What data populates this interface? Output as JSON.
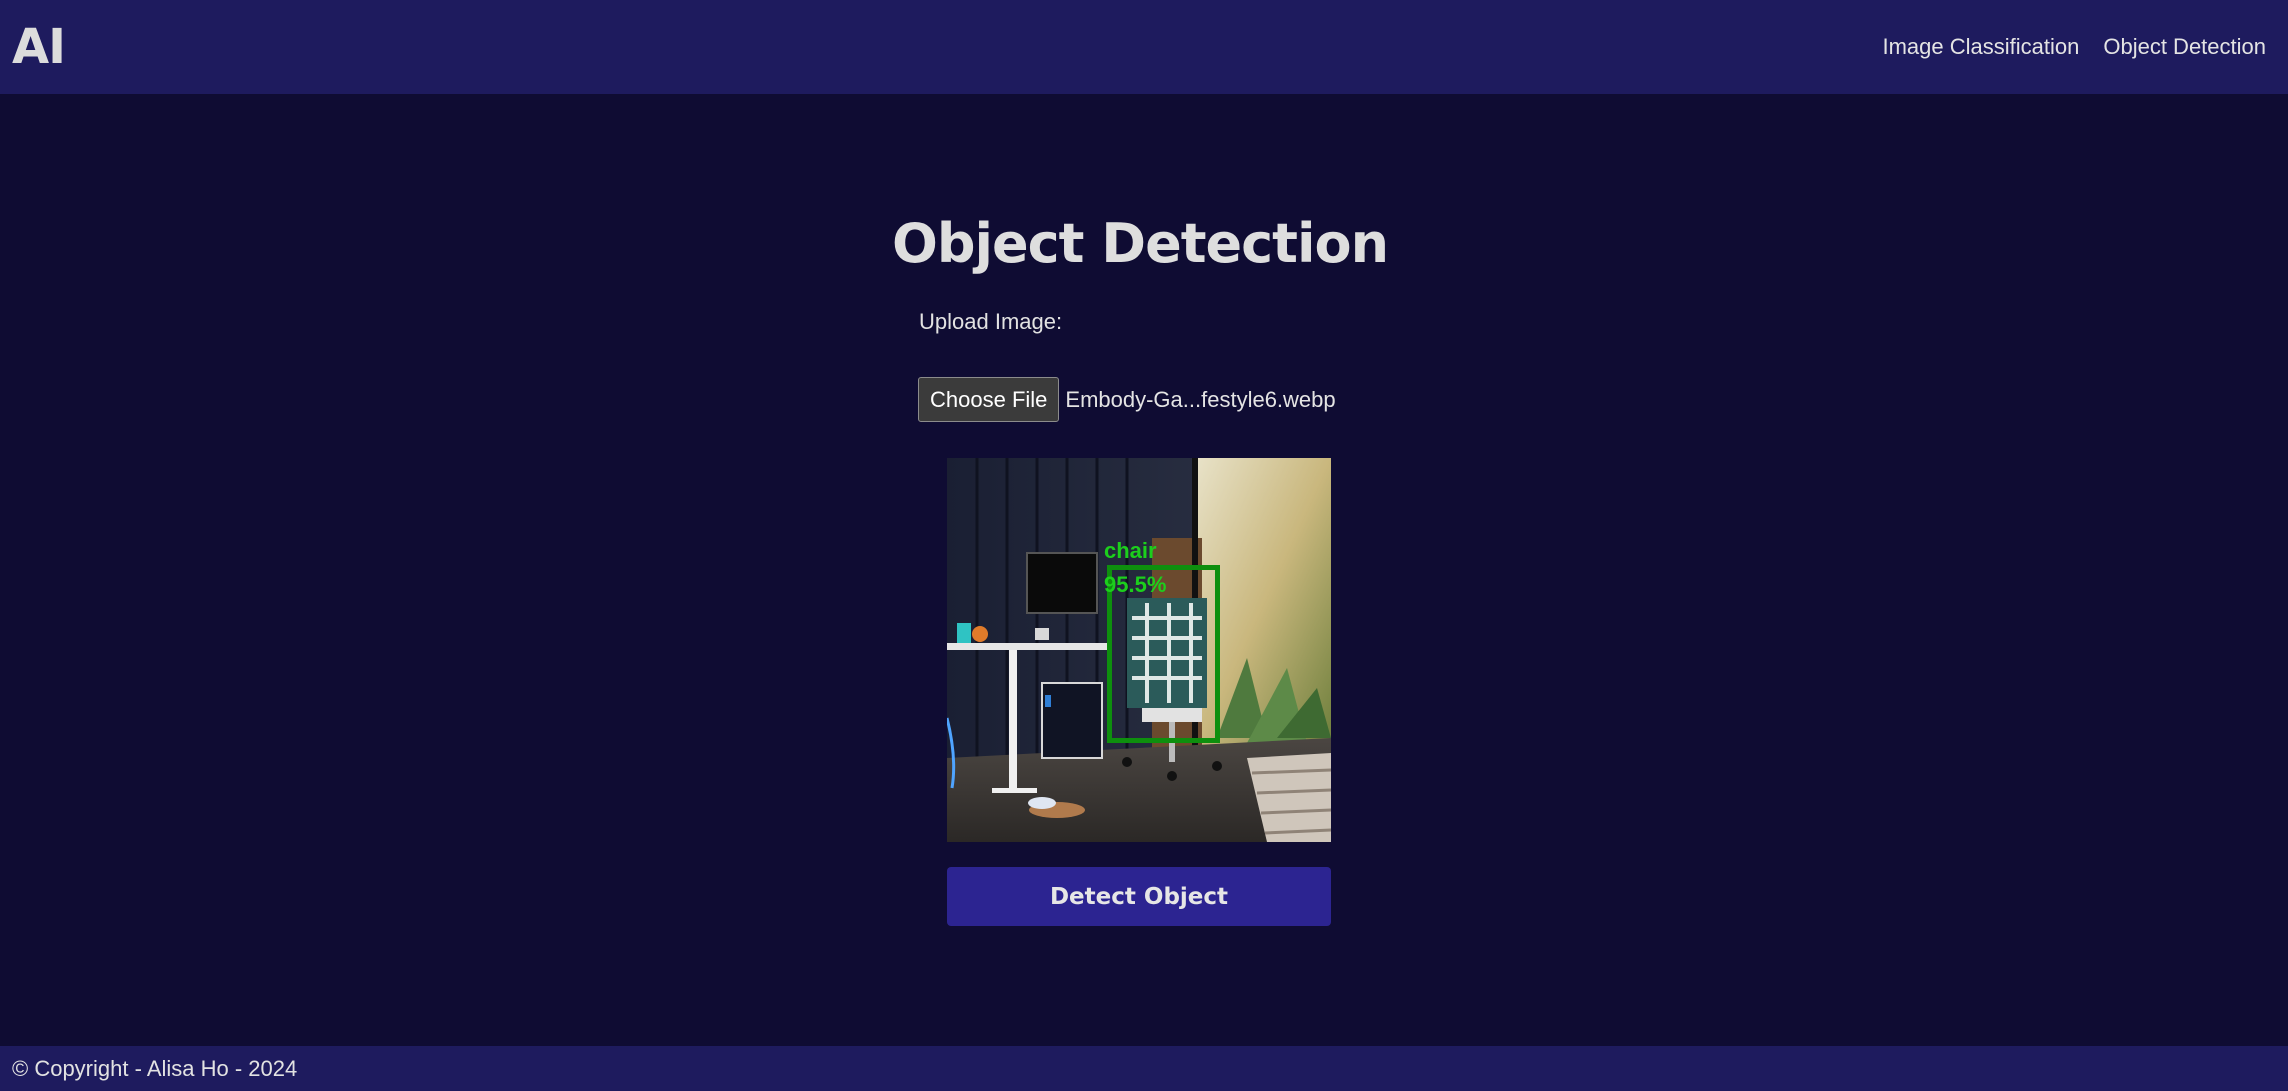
{
  "navbar": {
    "brand": "AI",
    "links": [
      {
        "label": "Image Classification"
      },
      {
        "label": "Object Detection"
      }
    ]
  },
  "main": {
    "title": "Object Detection",
    "upload_label": "Upload Image:",
    "file_input": {
      "button_label": "Choose File",
      "file_name": "Embody-Ga...festyle6.webp"
    },
    "detection": {
      "label": "chair",
      "score": "95.5%",
      "box_color": "#0e8f0e",
      "label_color": "#1ccf1c"
    },
    "detect_button_label": "Detect Object"
  },
  "footer": {
    "copyright": "© Copyright - Alisa Ho - 2024"
  },
  "colors": {
    "background": "#0f0c33",
    "navbar": "#1e1b5e",
    "button": "#2c2491"
  }
}
